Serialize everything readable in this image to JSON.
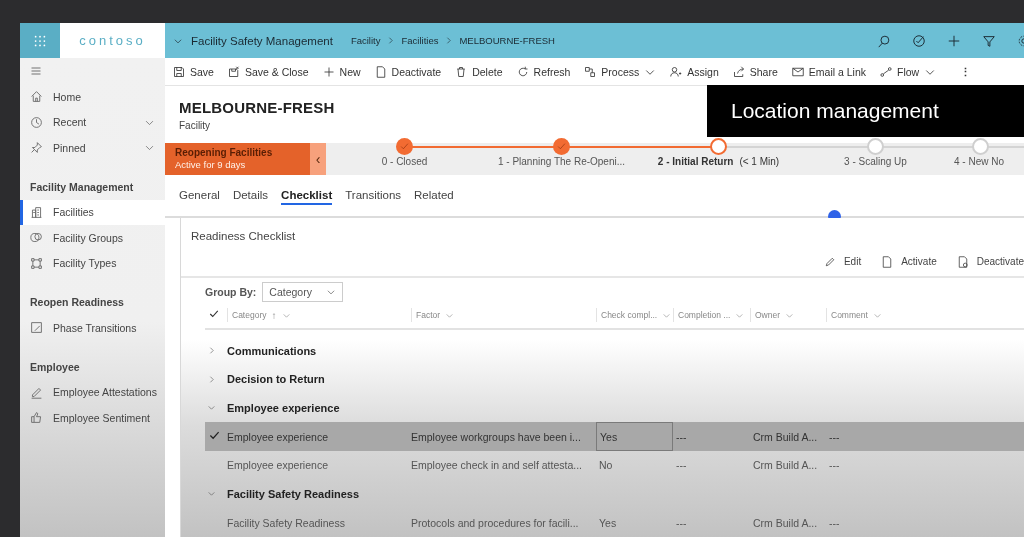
{
  "app": {
    "logo": "contoso",
    "app_name": "Facility Safety Management"
  },
  "breadcrumb": [
    "Facility",
    "Facilities",
    "MELBOURNE-FRESH"
  ],
  "command_bar": [
    {
      "label": "Save"
    },
    {
      "label": "Save & Close"
    },
    {
      "label": "New"
    },
    {
      "label": "Deactivate"
    },
    {
      "label": "Delete"
    },
    {
      "label": "Refresh"
    },
    {
      "label": "Process",
      "dropdown": true
    },
    {
      "label": "Assign"
    },
    {
      "label": "Share"
    },
    {
      "label": "Email a Link"
    },
    {
      "label": "Flow",
      "dropdown": true
    },
    {
      "label": "⋮",
      "kind": "more"
    }
  ],
  "sidebar": {
    "top_items": [
      {
        "label": "Home",
        "expandable": false
      },
      {
        "label": "Recent",
        "expandable": true
      },
      {
        "label": "Pinned",
        "expandable": true
      }
    ],
    "sections": [
      {
        "title": "Facility Management",
        "items": [
          {
            "label": "Facilities",
            "selected": true
          },
          {
            "label": "Facility Groups",
            "selected": false
          },
          {
            "label": "Facility Types",
            "selected": false
          }
        ]
      },
      {
        "title": "Reopen Readiness",
        "items": [
          {
            "label": "Phase Transitions",
            "selected": false
          }
        ]
      },
      {
        "title": "Employee",
        "items": [
          {
            "label": "Employee Attestations",
            "selected": false
          },
          {
            "label": "Employee Sentiment",
            "selected": false
          }
        ]
      }
    ]
  },
  "record": {
    "title": "MELBOURNE-FRESH",
    "entity": "Facility"
  },
  "process": {
    "name": "Reopening Facilities",
    "duration": "Active for 9 days",
    "collapse": "‹",
    "stages": [
      {
        "label": "0 - Closed",
        "completed": true,
        "active": false
      },
      {
        "label": "1 - Planning The Re-Openi...",
        "completed": true,
        "active": false
      },
      {
        "label": "2 - Initial Return",
        "time": "(< 1 Min)",
        "completed": false,
        "active": true
      },
      {
        "label": "3 - Scaling Up",
        "completed": false,
        "active": false
      },
      {
        "label": "4 - New No",
        "completed": false,
        "active": false
      }
    ]
  },
  "tabs": [
    {
      "label": "General",
      "selected": false
    },
    {
      "label": "Details",
      "selected": false
    },
    {
      "label": "Checklist",
      "selected": true
    },
    {
      "label": "Transitions",
      "selected": false
    },
    {
      "label": "Related",
      "selected": false
    }
  ],
  "checklist": {
    "title": "Readiness Checklist",
    "actions": [
      {
        "label": "Edit"
      },
      {
        "label": "Activate"
      },
      {
        "label": "Deactivate"
      }
    ],
    "group_by": {
      "label": "Group By:",
      "value": "Category"
    },
    "columns": [
      {
        "label": "Category",
        "sort": "↑"
      },
      {
        "label": "Factor"
      },
      {
        "label": "Check compl..."
      },
      {
        "label": "Completion ..."
      },
      {
        "label": "Owner"
      },
      {
        "label": "Comment"
      }
    ],
    "groups": [
      {
        "name": "Communications",
        "expanded": false
      },
      {
        "name": "Decision to Return",
        "expanded": false
      },
      {
        "name": "Employee experience",
        "expanded": true,
        "rows": [
          {
            "selected": true,
            "cells": [
              "Employee experience",
              "Employee workgroups have been i...",
              "Yes",
              "---",
              "Crm Build A...",
              "---"
            ]
          },
          {
            "selected": false,
            "cells": [
              "Employee experience",
              "Employee check in and self attesta...",
              "No",
              "---",
              "Crm Build A...",
              "---"
            ]
          }
        ]
      },
      {
        "name": "Facility Safety Readiness",
        "expanded": true,
        "rows": [
          {
            "selected": false,
            "cells": [
              "Facility Safety Readiness",
              "Protocols and procedures for facili...",
              "Yes",
              "---",
              "Crm Build A...",
              "---"
            ]
          }
        ]
      }
    ]
  },
  "caption": "Location management"
}
